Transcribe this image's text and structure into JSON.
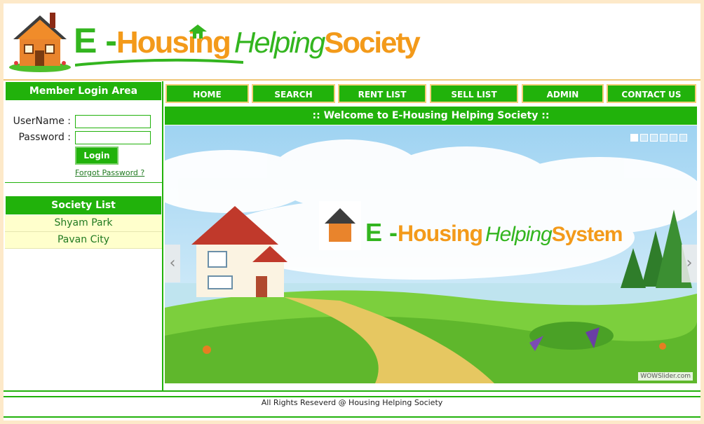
{
  "header": {
    "logo_e": "E -",
    "logo_housing": "Housing",
    "logo_helping": "Helping",
    "logo_society": "Society"
  },
  "sidebar": {
    "login_title": "Member Login Area",
    "username_label": "UserName :",
    "password_label": "Password :",
    "username_value": "",
    "password_value": "",
    "login_button": "Login",
    "forgot_link": "Forgot Password ?",
    "society_title": "Society List",
    "societies": [
      "Shyam Park",
      "Pavan City"
    ]
  },
  "nav": {
    "items": [
      "HOME",
      "SEARCH",
      "RENT LIST",
      "SELL LIST",
      "ADMIN",
      "CONTACT US"
    ]
  },
  "welcome": "::  Welcome to E-Housing Helping Society  ::",
  "slider": {
    "logo_e": "E -",
    "logo_housing": "Housing",
    "logo_helping": "Helping",
    "logo_system": "System",
    "prev_arrow": "‹",
    "next_arrow": "›",
    "credit": "WOWSlider.com",
    "active_slide": 1,
    "slide_count": 6
  },
  "footer": {
    "text": "All Rights Reseverd @ Housing Helping Society"
  },
  "colors": {
    "brand_green": "#21b20b",
    "brand_orange": "#f39a1a",
    "border_gold": "#f7cf7a",
    "list_bg": "#ffffcc"
  },
  "icons": [
    "house-logo-icon",
    "small-roof-icon",
    "chevron-left-icon",
    "chevron-right-icon"
  ]
}
